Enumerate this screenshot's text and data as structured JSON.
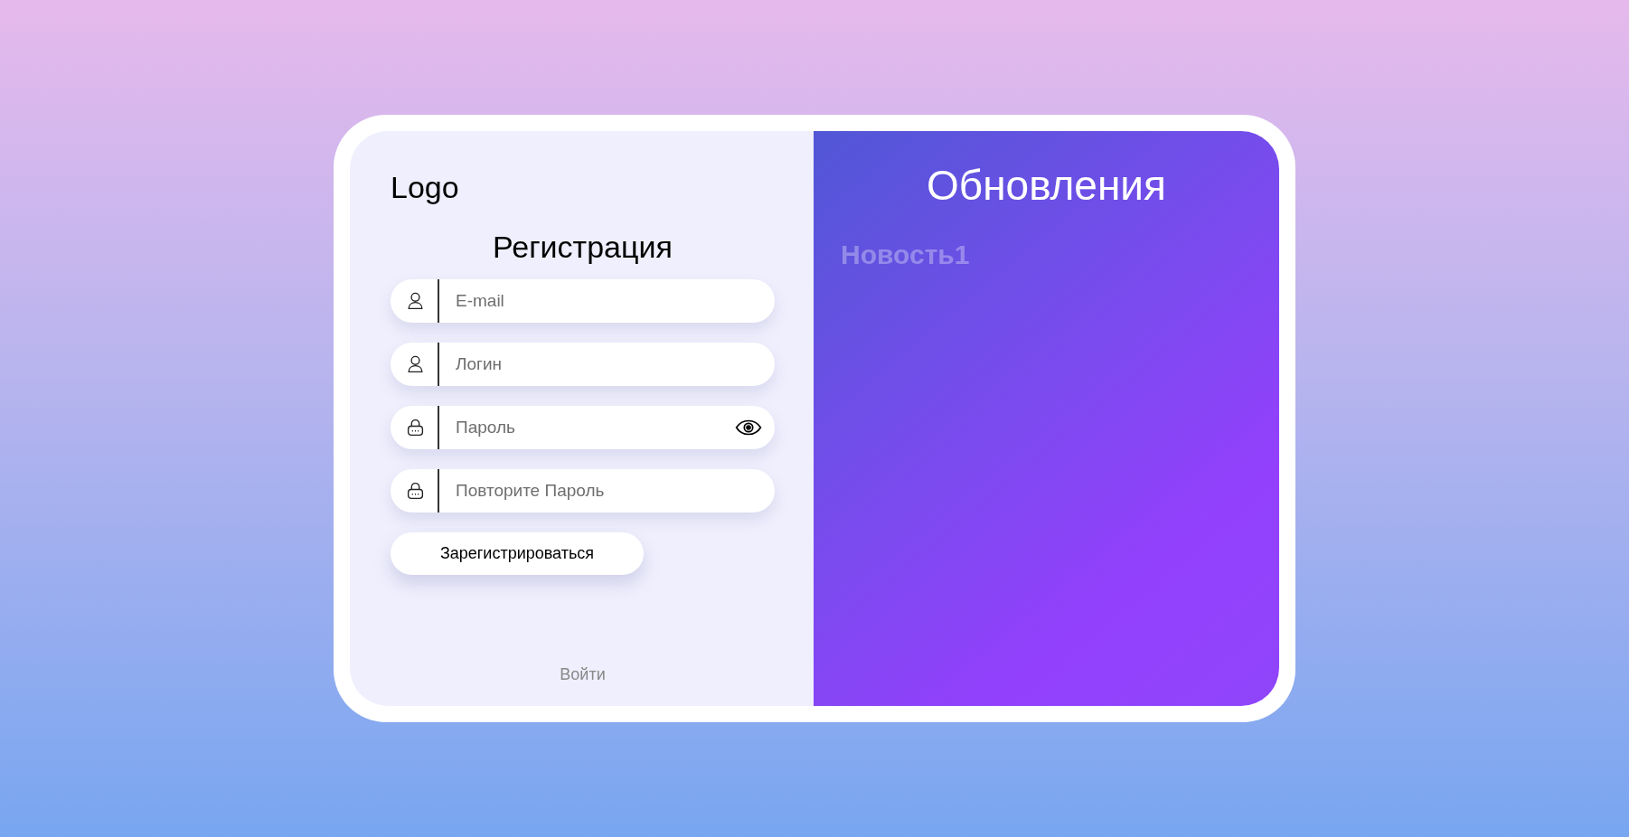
{
  "left_panel": {
    "logo": "Logo",
    "title": "Регистрация",
    "fields": [
      {
        "kind": "user",
        "placeholder": "E-mail",
        "show_password_button": false
      },
      {
        "kind": "user",
        "placeholder": "Логин",
        "show_password_button": false
      },
      {
        "kind": "lock",
        "placeholder": "Пароль",
        "show_password_button": true
      },
      {
        "kind": "lock",
        "placeholder": "Повторите Пароль",
        "show_password_button": false
      }
    ],
    "submit_button": "Зарегистрироваться",
    "login_link": "Войти"
  },
  "right_panel": {
    "title": "Обновления",
    "news": [
      "Новость1"
    ]
  }
}
